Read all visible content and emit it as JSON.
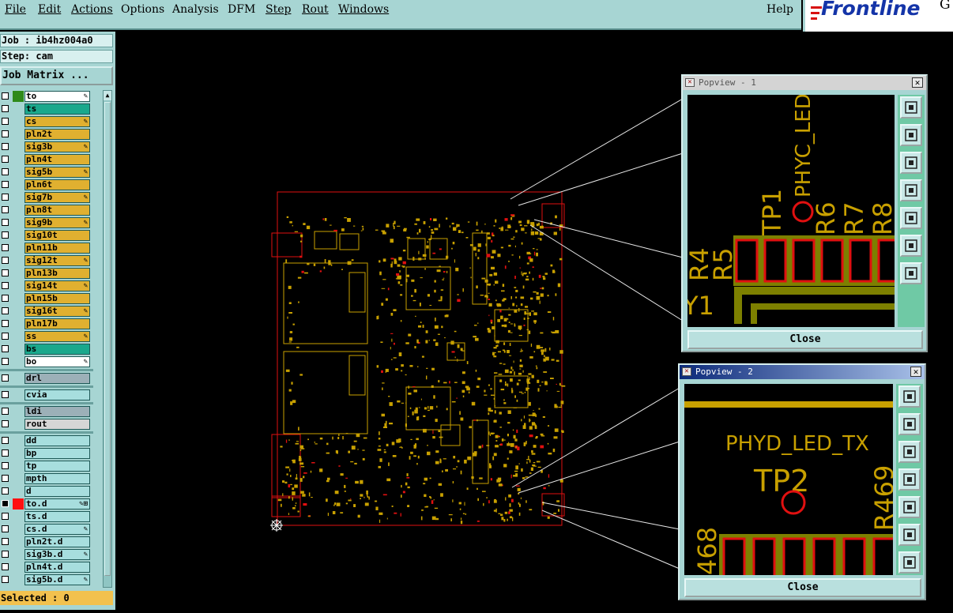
{
  "menu": {
    "items": [
      {
        "name": "file-menu",
        "label": "File"
      },
      {
        "name": "edit-menu",
        "label": "Edit"
      },
      {
        "name": "actions-menu",
        "label": "Actions"
      },
      {
        "name": "options-menu",
        "label": "Options"
      },
      {
        "name": "analysis-menu",
        "label": "Analysis"
      },
      {
        "name": "dfm-menu",
        "label": "DFM"
      },
      {
        "name": "step-menu",
        "label": "Step"
      },
      {
        "name": "rout-menu",
        "label": "Rout"
      },
      {
        "name": "windows-menu",
        "label": "Windows"
      }
    ],
    "help": "Help"
  },
  "brand": {
    "logo_text": "Frontline",
    "logo_trailing": "G"
  },
  "job": {
    "job_line": "Job : ib4hz004a0",
    "step_line": "Step: cam",
    "matrix_button": "Job Matrix ..."
  },
  "layers": [
    {
      "name": "to",
      "label": "to",
      "status": "green",
      "bg": "white",
      "mark": "✎"
    },
    {
      "name": "ts",
      "label": "ts",
      "status": "",
      "bg": "teal",
      "mark": ""
    },
    {
      "name": "cs",
      "label": "cs",
      "status": "",
      "bg": "yellow",
      "mark": "✎"
    },
    {
      "name": "pln2t",
      "label": "pln2t",
      "status": "",
      "bg": "yellow",
      "mark": ""
    },
    {
      "name": "sig3b",
      "label": "sig3b",
      "status": "",
      "bg": "yellow",
      "mark": "✎"
    },
    {
      "name": "pln4t",
      "label": "pln4t",
      "status": "",
      "bg": "yellow",
      "mark": ""
    },
    {
      "name": "sig5b",
      "label": "sig5b",
      "status": "",
      "bg": "yellow",
      "mark": "✎"
    },
    {
      "name": "pln6t",
      "label": "pln6t",
      "status": "",
      "bg": "yellow",
      "mark": ""
    },
    {
      "name": "sig7b",
      "label": "sig7b",
      "status": "",
      "bg": "yellow",
      "mark": "✎"
    },
    {
      "name": "pln8t",
      "label": "pln8t",
      "status": "",
      "bg": "yellow",
      "mark": ""
    },
    {
      "name": "sig9b",
      "label": "sig9b",
      "status": "",
      "bg": "yellow",
      "mark": "✎"
    },
    {
      "name": "sig10t",
      "label": "sig10t",
      "status": "",
      "bg": "yellow",
      "mark": ""
    },
    {
      "name": "pln11b",
      "label": "pln11b",
      "status": "",
      "bg": "yellow",
      "mark": ""
    },
    {
      "name": "sig12t",
      "label": "sig12t",
      "status": "",
      "bg": "yellow",
      "mark": "✎"
    },
    {
      "name": "pln13b",
      "label": "pln13b",
      "status": "",
      "bg": "yellow",
      "mark": ""
    },
    {
      "name": "sig14t",
      "label": "sig14t",
      "status": "",
      "bg": "yellow",
      "mark": "✎"
    },
    {
      "name": "pln15b",
      "label": "pln15b",
      "status": "",
      "bg": "yellow",
      "mark": ""
    },
    {
      "name": "sig16t",
      "label": "sig16t",
      "status": "",
      "bg": "yellow",
      "mark": "✎"
    },
    {
      "name": "pln17b",
      "label": "pln17b",
      "status": "",
      "bg": "yellow",
      "mark": ""
    },
    {
      "name": "ss",
      "label": "ss",
      "status": "",
      "bg": "yellow",
      "mark": "✎"
    },
    {
      "name": "bs",
      "label": "bs",
      "status": "",
      "bg": "teal",
      "mark": ""
    },
    {
      "name": "bo",
      "label": "bo",
      "status": "",
      "bg": "white",
      "mark": "✎"
    },
    {
      "name": "drl",
      "label": "drl",
      "status": "",
      "bg": "grey",
      "mark": "",
      "sep_before": true
    },
    {
      "name": "cvia",
      "label": "cvia",
      "status": "",
      "bg": "light",
      "mark": "",
      "sep_before": true
    },
    {
      "name": "ldi",
      "label": "ldi",
      "status": "",
      "bg": "grey",
      "mark": "",
      "sep_before": true
    },
    {
      "name": "rout",
      "label": "rout",
      "status": "",
      "bg": "silver",
      "mark": ""
    },
    {
      "name": "dd",
      "label": "dd",
      "status": "",
      "bg": "light",
      "mark": "",
      "sep_before": true
    },
    {
      "name": "bp",
      "label": "bp",
      "status": "",
      "bg": "light",
      "mark": ""
    },
    {
      "name": "tp",
      "label": "tp",
      "status": "",
      "bg": "light",
      "mark": ""
    },
    {
      "name": "mpth",
      "label": "mpth",
      "status": "",
      "bg": "light",
      "mark": ""
    },
    {
      "name": "d",
      "label": "d",
      "status": "",
      "bg": "light",
      "mark": ""
    },
    {
      "name": "to-d",
      "label": "to.d",
      "status": "red",
      "bg": "light",
      "mark": "✎⊞",
      "checkbox": "black"
    },
    {
      "name": "ts-d",
      "label": "ts.d",
      "status": "",
      "bg": "light",
      "mark": ""
    },
    {
      "name": "cs-d",
      "label": "cs.d",
      "status": "",
      "bg": "light",
      "mark": "✎"
    },
    {
      "name": "pln2t-d",
      "label": "pln2t.d",
      "status": "",
      "bg": "light",
      "mark": ""
    },
    {
      "name": "sig3b-d",
      "label": "sig3b.d",
      "status": "",
      "bg": "light",
      "mark": "✎"
    },
    {
      "name": "pln4t-d",
      "label": "pln4t.d",
      "status": "",
      "bg": "light",
      "mark": ""
    },
    {
      "name": "sig5b-d",
      "label": "sig5b.d",
      "status": "",
      "bg": "light",
      "mark": "✎"
    }
  ],
  "selected_text": "Selected : 0",
  "popview1": {
    "title": "Popview - 1",
    "close_label": "Close",
    "labels": {
      "net": "PHYC_LED_",
      "tp": "TP1",
      "r4": "R4",
      "r5": "R5",
      "r6": "R6",
      "r7": "R7",
      "r8": "R8",
      "y1": "Y1"
    }
  },
  "popview2": {
    "title": "Popview - 2",
    "close_label": "Close",
    "labels": {
      "net": "PHYD_LED_TX",
      "tp": "TP2",
      "r468": "468",
      "r469": "R469"
    }
  },
  "colors": {
    "copper": "#c8a000",
    "pad_green": "#b8c800",
    "red": "#e01010",
    "teal_panel": "#a7d5d3",
    "layer_yellow": "#e0b030",
    "layer_teal": "#1aa88c",
    "layer_light": "#a7dede",
    "layer_grey": "#9cb0b8"
  }
}
